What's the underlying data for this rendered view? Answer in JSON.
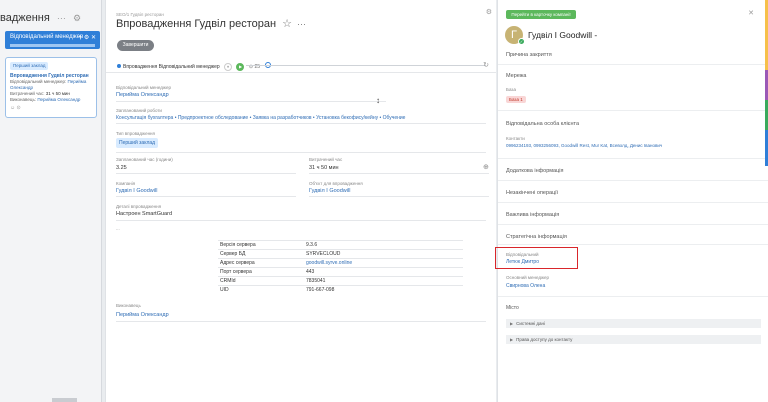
{
  "left": {
    "title": "вадження",
    "title_dots": "···",
    "title_icon": "⚙",
    "column": {
      "label": "Відповідальний менеджер",
      "icons": "+ ⚙ ✕"
    },
    "card": {
      "badge": "Перший заклад",
      "title": "Впровадження Гудвіл ресторан",
      "manager_label": "Відповідальний менеджер:",
      "manager_value": "Перийма Олександр",
      "time_label": "Витрачений час:",
      "time_value": "31 ч 50 мин",
      "executor_label": "Виконавець:",
      "executor_value": "Перийма Олександр",
      "icons": "☺ ⊙"
    }
  },
  "main": {
    "breadcrumb": "SEO/1 Гудвіл ресторан",
    "title": "Впровадження Гудвіл ресторан",
    "star": "☆",
    "title_dots": "···",
    "close_button": "Завершити",
    "stage": {
      "label": "Впровадження Відповідальний менеджер",
      "count": "25"
    },
    "fields": {
      "manager_label": "Відповідальний менеджер",
      "manager_value": "Перийма Олександр",
      "works_label": "Запланований роботи",
      "works_value": "Консультація бухгалтера • Предпроектное обследование • Заявка на разработчиков • Установка бекофису/кейну • Обучение",
      "type_label": "Тип впровадження",
      "type_value": "Перший заклад",
      "planned_time_label": "Запланований час (години)",
      "planned_time_value": "3.25",
      "spent_time_label": "Витрачений час",
      "spent_time_value": "31 ч 50 мин",
      "company_label": "Компанія",
      "company_value": "Гудвіл I Goodwill",
      "object_label": "Об'єкт для впровадження",
      "object_value": "Гудвіл I Goodwill",
      "details_label": "Деталі впровадження",
      "details_value": "Настроен SmartGuard",
      "executor_label": "Виконавець",
      "executor_value": "Перийма Олександр"
    },
    "server_table": [
      {
        "key": "Версія сервера",
        "value": "9.3.6"
      },
      {
        "key": "Сервер БД",
        "value": "SYRVECLOUD"
      },
      {
        "key": "Адрес сервера",
        "value": "goodwill.syrve.online"
      },
      {
        "key": "Порт сервера",
        "value": "443"
      },
      {
        "key": "CRMId",
        "value": "7835041"
      },
      {
        "key": "UID",
        "value": "791-667-098"
      }
    ]
  },
  "right": {
    "go_button": "Перейти в карточку компанії",
    "avatar_letter": "Г",
    "company_name": "Гудвіл I Goodwill -",
    "close_reason": "Причина закриття",
    "network": "Мережа",
    "base_label": "База",
    "base_value": "База 1",
    "responsible_label": "Відповідальна особа клієнта",
    "contacts_label": "Контакти",
    "contacts_value": "0996234193, 0993256093, Goodwill Rest, Mur Kat, Всеволд, Денис Іванович",
    "extra_info": "Додаткова інформація",
    "unfinished_ops": "Незакінчені операції",
    "important_info": "Важлива інформація",
    "strategic_info": "Стратегічна інформація",
    "responsible2_label": "Відповідальний",
    "responsible2_value": "Летюк Дмитро",
    "main_manager_label": "Основний менеджер",
    "main_manager_value": "Свирнова Олена",
    "place": "Місто",
    "collapsed1": "Системні дані",
    "collapsed2": "Права доступу до контакту"
  }
}
